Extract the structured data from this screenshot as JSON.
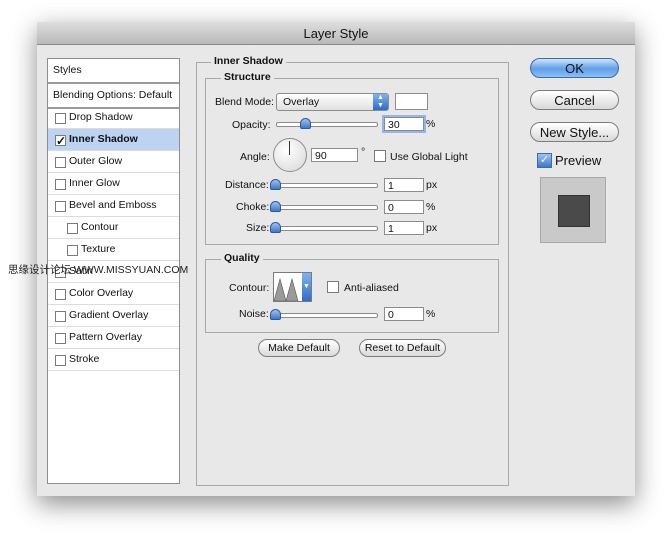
{
  "window": {
    "title": "Layer Style"
  },
  "sidebar": {
    "header": "Styles",
    "blending": "Blending Options: Default",
    "items": [
      {
        "label": "Drop Shadow",
        "checked": false,
        "indent": false,
        "selected": false
      },
      {
        "label": "Inner Shadow",
        "checked": true,
        "indent": false,
        "selected": true
      },
      {
        "label": "Outer Glow",
        "checked": false,
        "indent": false,
        "selected": false
      },
      {
        "label": "Inner Glow",
        "checked": false,
        "indent": false,
        "selected": false
      },
      {
        "label": "Bevel and Emboss",
        "checked": false,
        "indent": false,
        "selected": false
      },
      {
        "label": "Contour",
        "checked": false,
        "indent": true,
        "selected": false
      },
      {
        "label": "Texture",
        "checked": false,
        "indent": true,
        "selected": false
      },
      {
        "label": "Satin",
        "checked": false,
        "indent": false,
        "selected": false
      },
      {
        "label": "Color Overlay",
        "checked": false,
        "indent": false,
        "selected": false
      },
      {
        "label": "Gradient Overlay",
        "checked": false,
        "indent": false,
        "selected": false
      },
      {
        "label": "Pattern Overlay",
        "checked": false,
        "indent": false,
        "selected": false
      },
      {
        "label": "Stroke",
        "checked": false,
        "indent": false,
        "selected": false
      }
    ]
  },
  "inner_shadow": {
    "title": "Inner Shadow",
    "structure": {
      "title": "Structure",
      "blend_mode_label": "Blend Mode:",
      "blend_mode_value": "Overlay",
      "opacity_label": "Opacity:",
      "opacity_value": "30",
      "opacity_unit": "%",
      "angle_label": "Angle:",
      "angle_value": "90",
      "angle_unit": "°",
      "global_light_label": "Use Global Light",
      "distance_label": "Distance:",
      "distance_value": "1",
      "distance_unit": "px",
      "choke_label": "Choke:",
      "choke_value": "0",
      "choke_unit": "%",
      "size_label": "Size:",
      "size_value": "1",
      "size_unit": "px"
    },
    "quality": {
      "title": "Quality",
      "contour_label": "Contour:",
      "anti_aliased_label": "Anti-aliased",
      "noise_label": "Noise:",
      "noise_value": "0",
      "noise_unit": "%"
    },
    "make_default": "Make Default",
    "reset_default": "Reset to Default"
  },
  "actions": {
    "ok": "OK",
    "cancel": "Cancel",
    "new_style": "New Style...",
    "preview": "Preview"
  },
  "watermark": "思缘设计论坛 WWW.MISSYUAN.COM",
  "colors": {
    "accent": "#3e78c8",
    "selection": "#bcd3f2",
    "preview_swatch": "#4a4a4a"
  }
}
